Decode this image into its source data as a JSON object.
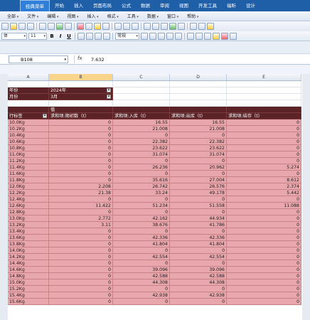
{
  "ribbon_tabs": [
    "经典菜单",
    "开始",
    "插入",
    "页面布局",
    "公式",
    "数据",
    "审阅",
    "视图",
    "开发工具",
    "福昕",
    "设计"
  ],
  "menu_items": [
    "全部",
    "文件",
    "编辑",
    "视图",
    "插入",
    "格式",
    "工具",
    "数据",
    "窗口",
    "帮助"
  ],
  "font_size": "11",
  "style_name": "常规",
  "name_box": "B108",
  "formula_value": "7.632",
  "columns": [
    "A",
    "B",
    "C",
    "D",
    "E"
  ],
  "filters": [
    {
      "label": "年份",
      "value": "2024年"
    },
    {
      "label": "月份",
      "value": "3月"
    }
  ],
  "value_header": "值",
  "headers": [
    "行标签",
    "求和项:期初数（t）",
    "求和项:入库（t）",
    "求和项:出库（t）",
    "求和项:结存（t）"
  ],
  "rows": [
    [
      "10.0Kg",
      "0",
      "16.55",
      "16.55",
      "0"
    ],
    [
      "10.2Kg",
      "0",
      "21.008",
      "21.008",
      "0"
    ],
    [
      "10.4Kg",
      "0",
      "0",
      "0",
      "0"
    ],
    [
      "10.6Kg",
      "0",
      "22.382",
      "22.382",
      "0"
    ],
    [
      "10.8Kg",
      "0",
      "23.622",
      "23.622",
      "0"
    ],
    [
      "11.0Kg",
      "0",
      "31.074",
      "31.074",
      "0"
    ],
    [
      "11.2Kg",
      "0",
      "0",
      "0",
      "0"
    ],
    [
      "11.4Kg",
      "0",
      "26.236",
      "20.962",
      "5.274"
    ],
    [
      "11.6Kg",
      "0",
      "0",
      "0",
      "0"
    ],
    [
      "11.8Kg",
      "0",
      "35.616",
      "27.004",
      "8.612"
    ],
    [
      "12.0Kg",
      "2.208",
      "26.742",
      "26.576",
      "2.374"
    ],
    [
      "12.2Kg",
      "21.38",
      "33.24",
      "49.178",
      "5.442"
    ],
    [
      "12.4Kg",
      "0",
      "0",
      "0",
      "0"
    ],
    [
      "12.6Kg",
      "11.422",
      "51.234",
      "51.558",
      "11.088"
    ],
    [
      "12.8Kg",
      "0",
      "0",
      "0",
      "0"
    ],
    [
      "13.0Kg",
      "2.772",
      "42.162",
      "44.934",
      "0"
    ],
    [
      "13.2Kg",
      "3.11",
      "38.676",
      "41.786",
      "0"
    ],
    [
      "13.4Kg",
      "0",
      "0",
      "0",
      "0"
    ],
    [
      "13.6Kg",
      "0",
      "42.336",
      "42.336",
      "0"
    ],
    [
      "13.8Kg",
      "0",
      "41.804",
      "41.804",
      "0"
    ],
    [
      "14.0Kg",
      "0",
      "0",
      "0",
      "0"
    ],
    [
      "14.2Kg",
      "0",
      "42.554",
      "42.554",
      "0"
    ],
    [
      "14.4Kg",
      "0",
      "0",
      "0",
      "0"
    ],
    [
      "14.6Kg",
      "0",
      "39.096",
      "39.096",
      "0"
    ],
    [
      "14.8Kg",
      "0",
      "42.588",
      "42.588",
      "0"
    ],
    [
      "15.0Kg",
      "0",
      "44.308",
      "44.308",
      "0"
    ],
    [
      "15.2Kg",
      "0",
      "0",
      "0",
      "0"
    ],
    [
      "15.4Kg",
      "0",
      "42.938",
      "42.938",
      "0"
    ],
    [
      "15.6Kg",
      "0",
      "0",
      "0",
      "0"
    ]
  ],
  "colors": {
    "dark_red": "#5b2326",
    "pink": "#e8a7ac",
    "ribbon": "#1f5fa8"
  }
}
